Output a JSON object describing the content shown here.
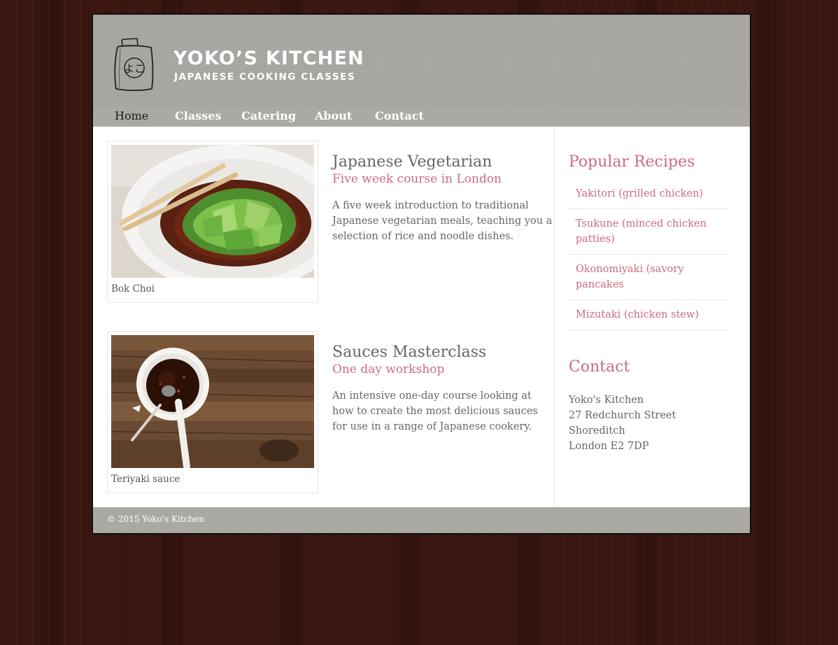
{
  "site": {
    "title": "YOKO’S KITCHEN",
    "subtitle": "JAPANESE COOKING CLASSES",
    "logo_text": "よこ"
  },
  "nav": {
    "items": [
      {
        "label": "Home",
        "current": true
      },
      {
        "label": "Classes"
      },
      {
        "label": "Catering"
      },
      {
        "label": "About"
      },
      {
        "label": "Contact"
      }
    ]
  },
  "courses": [
    {
      "image_caption": "Bok Choi",
      "title": "Japanese Vegetarian",
      "subtitle": "Five week course in London",
      "description": "A five week introduction to traditional Japanese vegetarian meals, teaching you a selection of rice and noodle dishes."
    },
    {
      "image_caption": "Teriyaki sauce",
      "title": "Sauces Masterclass",
      "subtitle": "One day workshop",
      "description": "An intensive one-day course looking at how to create the most delicious sauces for use in a range of Japanese cookery."
    }
  ],
  "sidebar": {
    "recipes_heading": "Popular Recipes",
    "recipes": [
      "Yakitori (grilled chicken)",
      "Tsukune (minced chicken patties)",
      "Okonomiyaki (savory pancakes",
      "Mizutaki (chicken stew)"
    ],
    "contact_heading": "Contact",
    "address": [
      "Yoko's Kitchen",
      "27 Redchurch Street",
      "Shoreditch",
      "London E2 7DP"
    ]
  },
  "footer": {
    "text": "© 2015 Yoko's Kitchen"
  },
  "colors": {
    "accent": "#cc6b83",
    "header_bg": "#a9a7a2",
    "text": "#666666",
    "page_bg": "#3b1610"
  }
}
